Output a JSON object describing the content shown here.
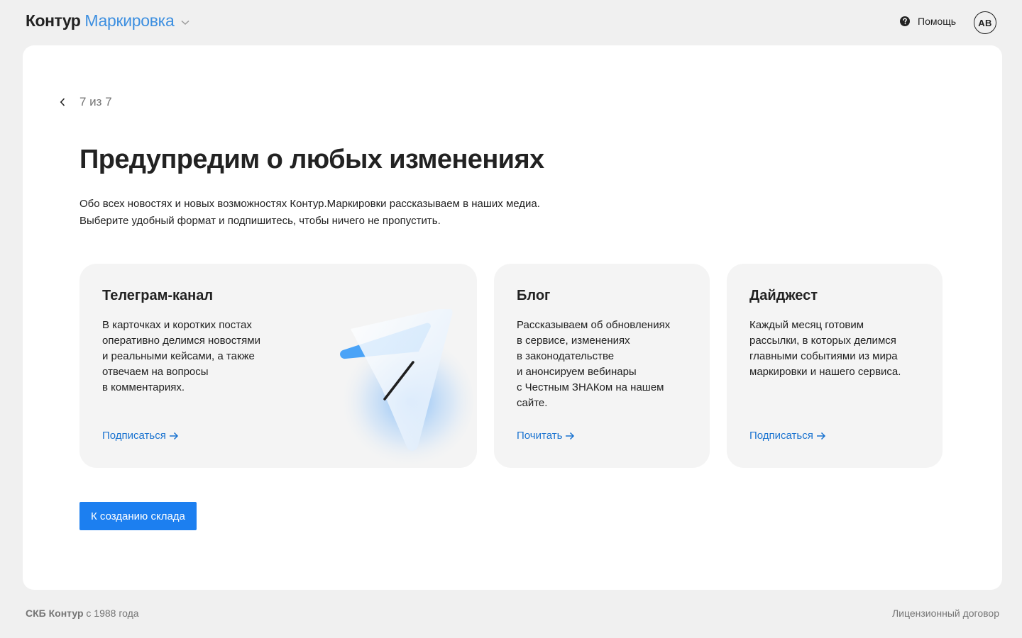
{
  "header": {
    "brand_primary": "Контур",
    "brand_product": "Маркировка",
    "help_label": "Помощь",
    "avatar_initials": "AB"
  },
  "main": {
    "step_text": "7 из 7",
    "title": "Предупредим о любых изменениях",
    "description": [
      "Обо всех новостях и новых возможностях Контур.Маркировки рассказываем в наших медиа.",
      "Выберите удобный формат и подпишитесь, чтобы ничего не пропустить."
    ],
    "cards": [
      {
        "title": "Телеграм-канал",
        "text": "В карточках и коротких постах\nоперативно делимся новостями\nи реальными кейсами, а также\nотвечаем на вопросы\nв комментариях.",
        "link": "Подписаться"
      },
      {
        "title": "Блог",
        "text": "Рассказываем об обновлениях\nв сервисе, изменениях\nв законодательстве\nи анонсируем вебинары\nс Честным ЗНАКом на нашем\nсайте.",
        "link": "Почитать"
      },
      {
        "title": "Дайджест",
        "text": "Каждый месяц готовим\nрассылки, в которых делимся\nглавными событиями из мира\nмаркировки и нашего сервиса.",
        "link": "Подписаться"
      }
    ],
    "cta_label": "К созданию склада"
  },
  "footer": {
    "company_bold": "СКБ Контур",
    "company_rest": " с 1988 года",
    "license_link": "Лицензионный договор"
  },
  "colors": {
    "brand_blue": "#3d8fe0",
    "link_blue": "#1a73d0",
    "button_blue": "#1c7ff0",
    "page_bg": "#f0f0f0",
    "card_bg": "#f4f4f4"
  },
  "icons": [
    "chevron-down-icon",
    "help-circle-icon",
    "chevron-left-icon",
    "arrow-right-icon",
    "telegram-plane-illustration"
  ]
}
